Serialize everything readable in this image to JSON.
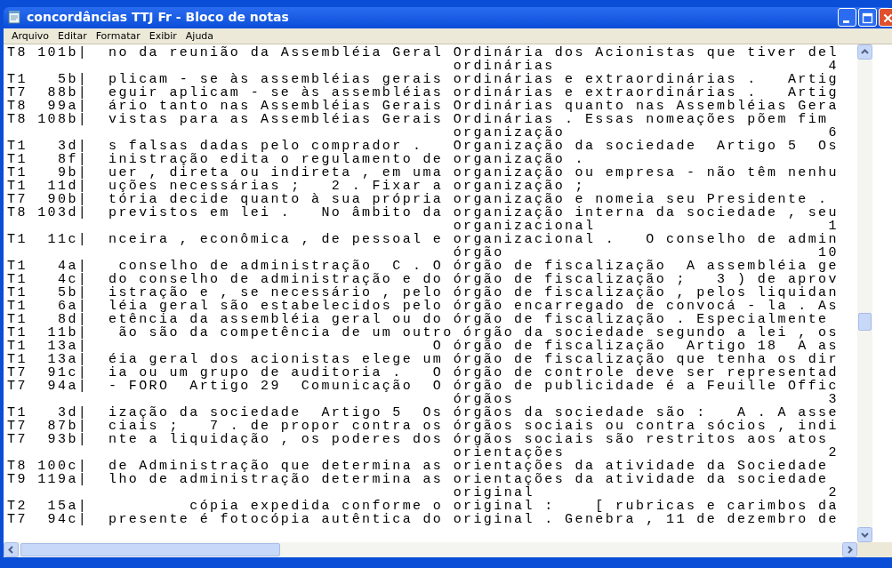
{
  "window": {
    "title": "concordâncias TTJ Fr - Bloco de notas"
  },
  "menu": [
    "Arquivo",
    "Editar",
    "Formatar",
    "Exibir",
    "Ajuda"
  ],
  "lines": [
    "T8 101b|  no da reunião da Assembléia Geral Ordinária dos Acionistas que tiver del",
    "                                            ordinárias                           4",
    "T1   5b|  plicam - se às assembléias gerais ordinárias e extraordinárias .   Artig",
    "T7  88b|  eguir aplicam - se às assembléias ordinárias e extraordinárias .   Artig",
    "T8  99a|  ário tanto nas Assembléias Gerais Ordinárias quanto nas Assembléias Gera",
    "T8 108b|  vistas para as Assembléias Gerais Ordinárias . Essas nomeações põem fim",
    "                                            organização                          6",
    "T1   3d|  s falsas dadas pelo comprador .   Organização da sociedade  Artigo 5  Os",
    "T1   8f|  inistração edita o regulamento de organização .",
    "T1   9b|  uer , direta ou indireta , em uma organização ou empresa - não têm nenhu",
    "T1  11d|  uções necessárias ;   2 . Fixar a organização ;",
    "T7  90b|  tória decide quanto à sua própria organização e nomeia seu Presidente .",
    "T8 103d|  previstos em lei .   No âmbito da organização interna da sociedade , seu",
    "                                            organizacional                       1",
    "T1  11c|  nceira , econômica , de pessoal e organizacional .   O conselho de admin",
    "                                            órgão                               10",
    "T1   4a|   conselho de administração  C . O órgão de fiscalização  A assembléia ge",
    "T1   4c|  do conselho de administração e do órgão de fiscalização ;   3 ) de aprov",
    "T1   5b|  istração e , se necessário , pelo órgão de fiscalização , pelos liquidan",
    "T1   6a|  léia geral são estabelecidos pelo órgão encarregado de convocá - la . As",
    "T1   8d|  etência da assembléia geral ou do órgão de fiscalização . Especialmente",
    "T1  11b|   ão são da competência de um outro órgão da sociedade segundo a lei , os",
    "T1  13a|                                  O órgão de fiscalização  Artigo 18  A as",
    "T1  13a|  éia geral dos acionistas elege um órgão de fiscalização que tenha os dir",
    "T7  91c|  ia ou um grupo de auditoria .   O órgão de controle deve ser representad",
    "T7  94a|  - FORO  Artigo 29  Comunicação  O órgão de publicidade é a Feuille Offic",
    "                                            órgãos                               3",
    "T1   3d|  ização da sociedade  Artigo 5  Os órgãos da sociedade são :   A . A asse",
    "T7  87b|  ciais ;   7 . de propor contra os órgãos sociais ou contra sócios , indi",
    "T7  93b|  nte a liquidação , os poderes dos órgãos sociais são restritos aos atos",
    "                                            orientações                          2",
    "T8 100c|  de Administração que determina as orientações da atividade da Sociedade",
    "T9 119a|  lho de administração determina as orientações da atividade da sociedade",
    "                                            original                             2",
    "T2  15a|          cópia expedida conforme o original :    [ rubricas e carimbos da",
    "T7  94c|  presente é fotocópia autêntica do original . Genebra , 11 de dezembro de"
  ]
}
